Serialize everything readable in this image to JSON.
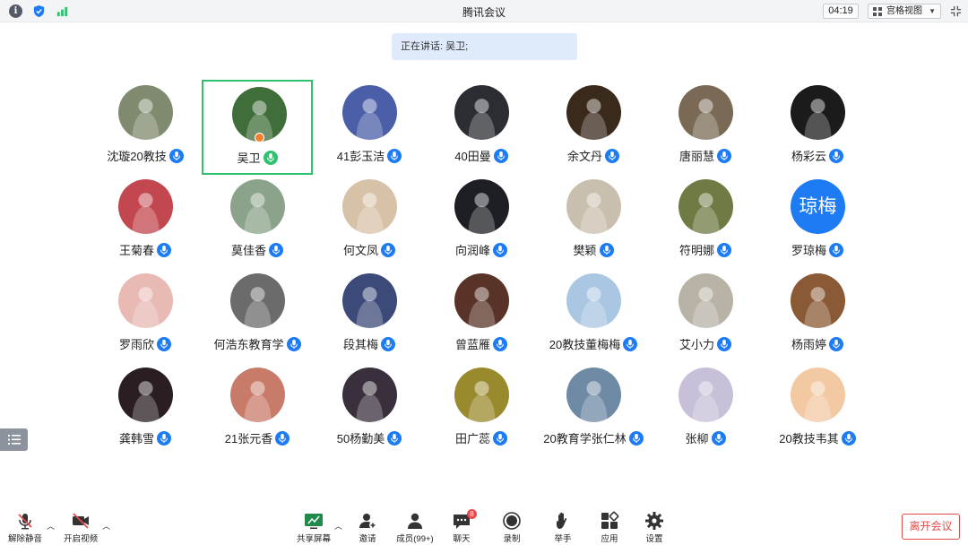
{
  "window": {
    "title": "腾讯会议",
    "timer": "04:19",
    "view_mode": "宫格视图"
  },
  "speaking_banner": "正在讲话: 吴卫;",
  "colors": {
    "accent": "#1d7bf3",
    "active_border": "#2ec26f",
    "danger": "#e14b4b",
    "host_badge": "#f5802b",
    "unread_badge": "#f0484a"
  },
  "participants": [
    {
      "name": "沈璇20教技",
      "avatar_icon": "photo",
      "avatar_color": "#7f8a6e"
    },
    {
      "name": "吴卫",
      "avatar_icon": "cartoon-photo",
      "avatar_color": "#3f6e3a",
      "speaking": true,
      "host": true
    },
    {
      "name": "41彭玉洁",
      "avatar_icon": "anime-photo",
      "avatar_color": "#4a5fa8"
    },
    {
      "name": "40田曼",
      "avatar_icon": "photo",
      "avatar_color": "#2b2d33"
    },
    {
      "name": "余文丹",
      "avatar_icon": "photo",
      "avatar_color": "#3a2a1c"
    },
    {
      "name": "唐丽慧",
      "avatar_icon": "photo",
      "avatar_color": "#7a6a55"
    },
    {
      "name": "杨彩云",
      "avatar_icon": "flower-photo",
      "avatar_color": "#1b1b1b"
    },
    {
      "name": "王菊春",
      "avatar_icon": "photo",
      "avatar_color": "#c2474e"
    },
    {
      "name": "莫佳香",
      "avatar_icon": "photo",
      "avatar_color": "#8aa38a"
    },
    {
      "name": "何文凤",
      "avatar_icon": "cat-photo",
      "avatar_color": "#d7c2a8"
    },
    {
      "name": "向润峰",
      "avatar_icon": "car-photo",
      "avatar_color": "#1e1f24"
    },
    {
      "name": "樊颖",
      "avatar_icon": "cat-photo",
      "avatar_color": "#c9bfae"
    },
    {
      "name": "符明娜",
      "avatar_icon": "toy-photo",
      "avatar_color": "#6e7b44"
    },
    {
      "name": "罗琼梅",
      "avatar_text": "琼梅",
      "avatar_color": "#1d7bf3"
    },
    {
      "name": "罗雨欣",
      "avatar_icon": "illustration",
      "avatar_color": "#e9b9b4"
    },
    {
      "name": "何浩东教育学",
      "avatar_icon": "bw-photo",
      "avatar_color": "#6b6b6b"
    },
    {
      "name": "段其梅",
      "avatar_icon": "sky-photo",
      "avatar_color": "#3b4a78"
    },
    {
      "name": "曾蓝雁",
      "avatar_icon": "photo",
      "avatar_color": "#5a3328"
    },
    {
      "name": "20教技董梅梅",
      "avatar_icon": "illustration",
      "avatar_color": "#a9c6e2"
    },
    {
      "name": "艾小力",
      "avatar_icon": "photo",
      "avatar_color": "#b9b2a6"
    },
    {
      "name": "杨雨婷",
      "avatar_icon": "dog-photo",
      "avatar_color": "#8a5a36"
    },
    {
      "name": "龚韩雪",
      "avatar_icon": "photo",
      "avatar_color": "#2a1e22"
    },
    {
      "name": "21张元香",
      "avatar_icon": "illustration",
      "avatar_color": "#c97b6a"
    },
    {
      "name": "50杨勤美",
      "avatar_icon": "anime-photo",
      "avatar_color": "#3a2f3c"
    },
    {
      "name": "田广蕊",
      "avatar_icon": "sign-photo",
      "avatar_color": "#9a8a2e"
    },
    {
      "name": "20教育学张仁林",
      "avatar_icon": "photo",
      "avatar_color": "#6e8aa5"
    },
    {
      "name": "张柳",
      "avatar_icon": "anime-photo",
      "avatar_color": "#c8bfd8"
    },
    {
      "name": "20教技韦其",
      "avatar_icon": "cartoon",
      "avatar_color": "#f3c9a3"
    }
  ],
  "toolbar": {
    "unmute": "解除静音",
    "start_video": "开启视频",
    "share_screen": "共享屏幕",
    "invite": "邀请",
    "members": "成员(99+)",
    "chat": "聊天",
    "chat_badge": "8",
    "record": "录制",
    "raise_hand": "举手",
    "apps": "应用",
    "settings": "设置",
    "leave": "离开会议"
  }
}
